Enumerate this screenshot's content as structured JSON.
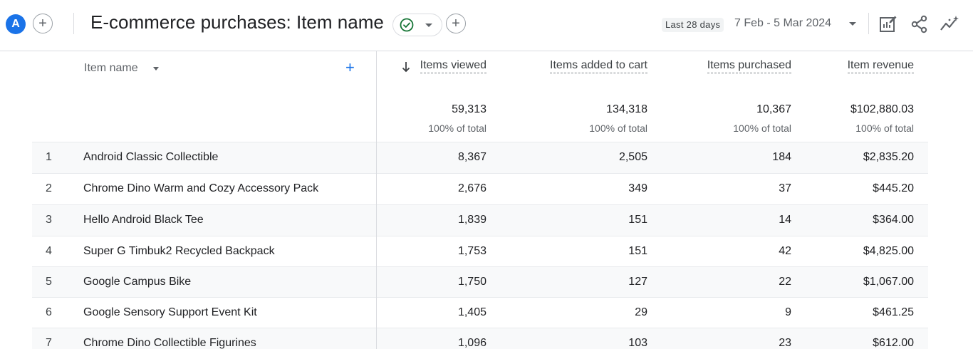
{
  "header": {
    "avatar_letter": "A",
    "title": "E-commerce purchases: Item name",
    "date_badge": "Last 28 days",
    "date_range": "7 Feb - 5 Mar 2024"
  },
  "table": {
    "dimension_label": "Item name",
    "columns": [
      {
        "label": "Items viewed",
        "total": "59,313",
        "pct": "100% of total"
      },
      {
        "label": "Items added to cart",
        "total": "134,318",
        "pct": "100% of total"
      },
      {
        "label": "Items purchased",
        "total": "10,367",
        "pct": "100% of total"
      },
      {
        "label": "Item revenue",
        "total": "$102,880.03",
        "pct": "100% of total"
      }
    ],
    "rows": [
      {
        "idx": "1",
        "name": "Android Classic Collectible",
        "viewed": "8,367",
        "cart": "2,505",
        "purchased": "184",
        "revenue": "$2,835.20"
      },
      {
        "idx": "2",
        "name": "Chrome Dino Warm and Cozy Accessory Pack",
        "viewed": "2,676",
        "cart": "349",
        "purchased": "37",
        "revenue": "$445.20"
      },
      {
        "idx": "3",
        "name": "Hello Android Black Tee",
        "viewed": "1,839",
        "cart": "151",
        "purchased": "14",
        "revenue": "$364.00"
      },
      {
        "idx": "4",
        "name": "Super G Timbuk2 Recycled Backpack",
        "viewed": "1,753",
        "cart": "151",
        "purchased": "42",
        "revenue": "$4,825.00"
      },
      {
        "idx": "5",
        "name": "Google Campus Bike",
        "viewed": "1,750",
        "cart": "127",
        "purchased": "22",
        "revenue": "$1,067.00"
      },
      {
        "idx": "6",
        "name": "Google Sensory Support Event Kit",
        "viewed": "1,405",
        "cart": "29",
        "purchased": "9",
        "revenue": "$461.25"
      },
      {
        "idx": "7",
        "name": "Chrome Dino Collectible Figurines",
        "viewed": "1,096",
        "cart": "103",
        "purchased": "23",
        "revenue": "$612.00"
      }
    ]
  },
  "icons": {
    "check": "check-circle-icon",
    "edit": "customize-report-icon",
    "share": "share-icon",
    "insights": "insights-icon"
  },
  "colors": {
    "accent": "#1a73e8",
    "success": "#137333"
  }
}
